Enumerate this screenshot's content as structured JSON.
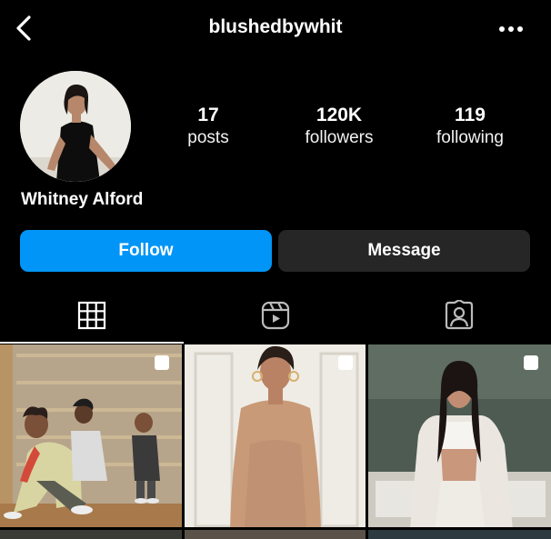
{
  "profile": {
    "username": "blushedbywhit",
    "full_name": "Whitney Alford"
  },
  "stats": {
    "posts": {
      "value": "17",
      "label": "posts"
    },
    "followers": {
      "value": "120K",
      "label": "followers"
    },
    "following": {
      "value": "119",
      "label": "following"
    }
  },
  "actions": {
    "follow_label": "Follow",
    "message_label": "Message"
  },
  "tabs": [
    {
      "name": "grid",
      "icon": "grid-icon",
      "selected": true
    },
    {
      "name": "reels",
      "icon": "reels-icon",
      "selected": false
    },
    {
      "name": "tagged",
      "icon": "tagged-icon",
      "selected": false
    }
  ],
  "posts": [
    {
      "icon": "multiple-posts-icon"
    },
    {
      "icon": "multiple-posts-icon"
    },
    {
      "icon": "multiple-posts-icon"
    }
  ],
  "colors": {
    "background": "#000000",
    "follow_button": "#0095f6",
    "message_button": "#262626",
    "text": "#ffffff"
  }
}
